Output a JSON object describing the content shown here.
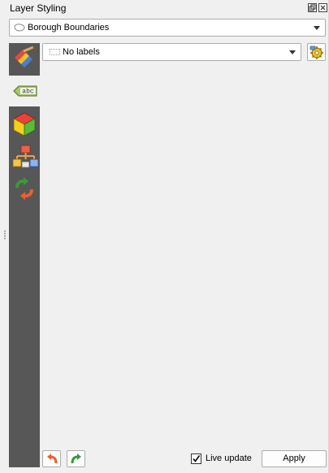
{
  "panel": {
    "title": "Layer Styling",
    "float_icon": "float-icon",
    "close_icon": "close-icon"
  },
  "layer_selector": {
    "value": "Borough Boundaries",
    "icon": "polygon-layer-icon"
  },
  "sidebar": {
    "items": [
      {
        "name": "symbology",
        "icon": "paintbrush-icon"
      },
      {
        "name": "labels",
        "icon": "labels-abc-icon",
        "text": "abc"
      },
      {
        "name": "3d-view",
        "icon": "cube-3d-icon"
      },
      {
        "name": "diagrams",
        "icon": "diagram-icon"
      },
      {
        "name": "history",
        "icon": "history-icon"
      }
    ]
  },
  "labels": {
    "mode": "No labels",
    "rules_icon": "rule-based-labels-icon"
  },
  "footer": {
    "undo_icon": "undo-icon",
    "redo_icon": "redo-icon",
    "live_update_label": "Live update",
    "live_update_checked": true,
    "apply_label": "Apply"
  }
}
